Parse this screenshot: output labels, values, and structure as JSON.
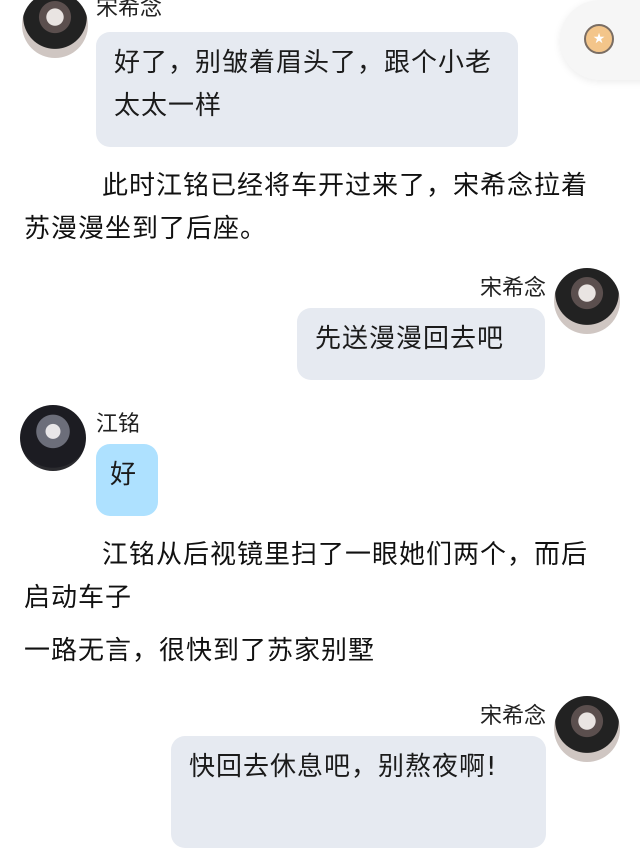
{
  "messages": [
    {
      "speaker": "宋希念",
      "text": "好了，别皱着眉头了，跟个小老太太一样"
    },
    {
      "speaker": "宋希念",
      "text": "先送漫漫回去吧"
    },
    {
      "speaker": "江铭",
      "text": "好"
    },
    {
      "speaker": "宋希念",
      "text": "快回去休息吧，别熬夜啊!"
    }
  ],
  "narration": [
    "此时江铭已经将车开过来了，宋希念拉着苏漫漫坐到了后座。",
    "江铭从后视镜里扫了一眼她们两个，而后启动车子",
    "一路无言，很快到了苏家别墅"
  ],
  "float_button": {
    "icon": "star-icon"
  }
}
